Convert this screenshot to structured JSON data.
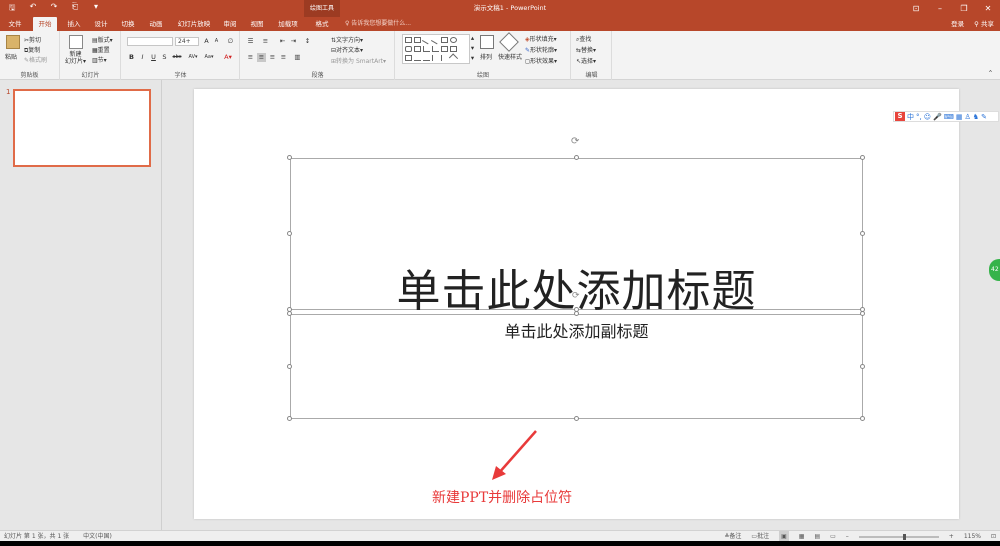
{
  "titlebar": {
    "quick_access": [
      "save-icon",
      "undo-icon",
      "redo-icon",
      "start-icon",
      "customize-icon"
    ],
    "context_tool": "绘图工具",
    "document_title": "演示文稿1 - PowerPoint",
    "window_controls": [
      "ribbon-options-icon",
      "minimize-icon",
      "restore-icon",
      "close-icon"
    ]
  },
  "tabs": [
    {
      "label": "文件"
    },
    {
      "label": "开始"
    },
    {
      "label": "插入"
    },
    {
      "label": "设计"
    },
    {
      "label": "切换"
    },
    {
      "label": "动画"
    },
    {
      "label": "幻灯片放映"
    },
    {
      "label": "审阅"
    },
    {
      "label": "视图"
    },
    {
      "label": "加载项"
    },
    {
      "label": "格式"
    }
  ],
  "tell_me": "♀ 告诉我您想要做什么...",
  "account": {
    "signin": "登录",
    "share": "共享"
  },
  "ribbon": {
    "clipboard": {
      "label": "剪贴板",
      "paste": "粘贴",
      "cut": "剪切",
      "copy": "复制",
      "format_painter": "格式刷"
    },
    "slides": {
      "label": "幻灯片",
      "new_slide": "新建\n幻灯片▾",
      "layout": "版式▾",
      "reset": "重置",
      "section": "节▾"
    },
    "font": {
      "label": "字体",
      "font_name": "",
      "font_size": "24+",
      "bold": "B",
      "italic": "I",
      "underline": "U",
      "shadow": "S",
      "strike": "abc",
      "spacing": "AV▾",
      "case": "Aa▾",
      "color": "A▾"
    },
    "paragraph": {
      "label": "段落",
      "text_direction": "文字方向▾",
      "align_text": "对齐文本▾",
      "smartart": "转换为 SmartArt▾"
    },
    "drawing": {
      "label": "绘图",
      "arrange": "排列",
      "quick_styles": "快速样式",
      "fill": "形状填充▾",
      "outline": "形状轮廓▾",
      "effects": "形状效果▾"
    },
    "editing": {
      "label": "编辑",
      "find": "查找",
      "replace": "替换▾",
      "select": "选择▾"
    }
  },
  "thumbnails": {
    "slide_number": "1"
  },
  "slide": {
    "title_placeholder": "单击此处添加标题",
    "subtitle_placeholder": "单击此处添加副标题"
  },
  "annotation": "新建PPT并删除占位符",
  "ime": {
    "logo": "S",
    "mode": "中",
    "punct": "°,"
  },
  "side_badge": "42",
  "statusbar": {
    "slide_info": "幻灯片 第 1 张，共 1 张",
    "language": "中文(中国)",
    "notes": "备注",
    "comments": "批注",
    "zoom": "115%"
  },
  "colors": {
    "accent": "#b7472a",
    "annotation": "#e83a3a"
  }
}
